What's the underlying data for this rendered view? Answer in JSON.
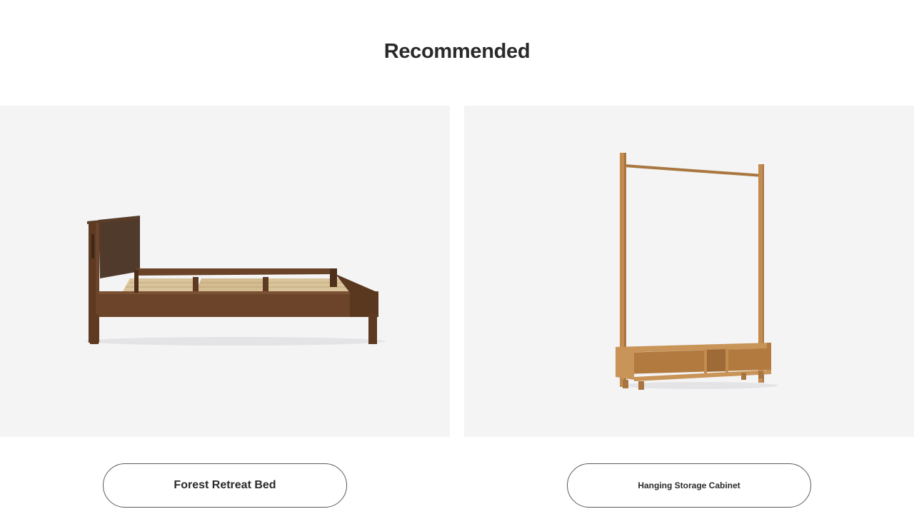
{
  "section": {
    "title": "Recommended"
  },
  "products": [
    {
      "name": "Forest Retreat Bed",
      "image_subject": "walnut platform bed with slatted base",
      "wood_color": "#5e3a22"
    },
    {
      "name": "Hanging Storage Cabinet",
      "image_subject": "oak clothes rail with low storage shelf",
      "wood_color": "#b9844b"
    }
  ],
  "colors": {
    "image_background": "#f4f4f5",
    "text": "#2a2a2a",
    "button_border": "#5a5a5a"
  }
}
